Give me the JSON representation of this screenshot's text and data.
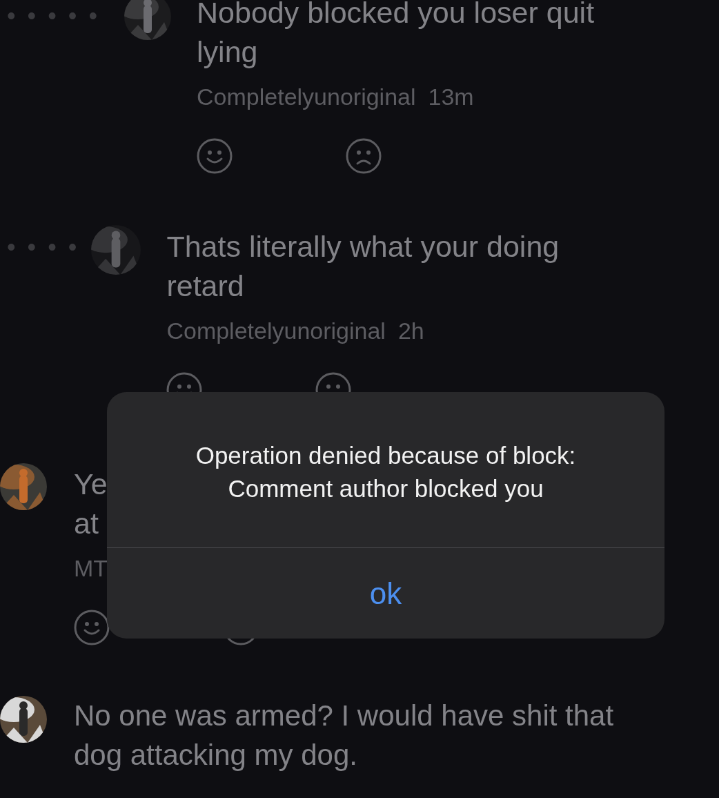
{
  "comments": [
    {
      "thread_marker": "•••••",
      "lines": [
        "Nobody blocked you loser quit",
        "lying"
      ],
      "author": "Completelyunoriginal",
      "time": "13m"
    },
    {
      "thread_marker": "••••",
      "lines": [
        "Thats literally what your doing",
        "retard"
      ],
      "author": "Completelyunoriginal",
      "time": "2h"
    },
    {
      "lines": [
        "Ye",
        "at"
      ],
      "author": "MT"
    },
    {
      "lines": [
        "No one was armed? I would have shit that",
        "dog attacking my dog."
      ]
    }
  ],
  "alert": {
    "message_lines": [
      "Operation denied because of block:",
      "Comment author blocked you"
    ],
    "button": "ok"
  }
}
